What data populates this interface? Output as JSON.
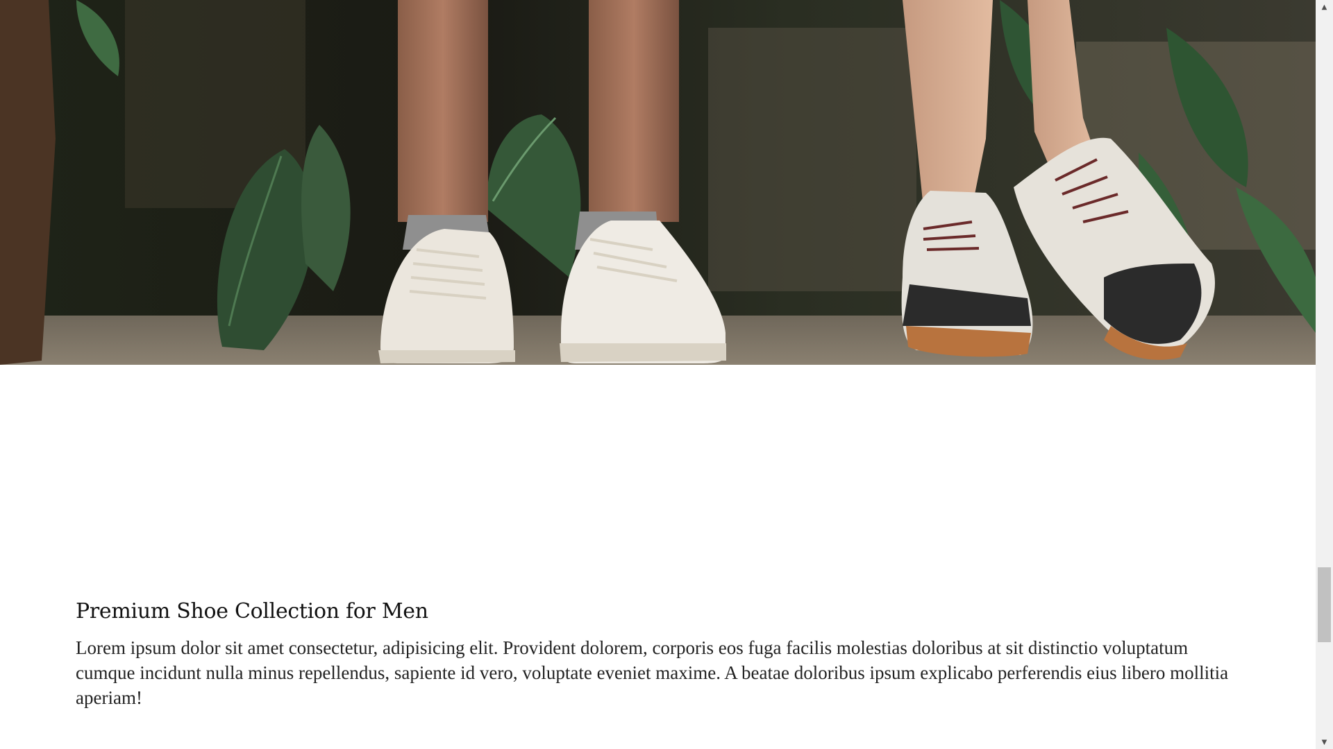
{
  "hero": {
    "image_alt": "Close-up of legs wearing white sneakers among tropical plants"
  },
  "section": {
    "title": "Premium Shoe Collection for Men",
    "body": "Lorem ipsum dolor sit amet consectetur, adipisicing elit. Provident dolorem, corporis eos fuga facilis molestias doloribus at sit distinctio voluptatum cumque incidunt nulla minus repellendus, sapiente id vero, voluptate eveniet maxime. A beatae doloribus ipsum explicabo perferendis eius libero mollitia aperiam!"
  },
  "scrollbar": {
    "up_icon": "triangle-up-icon",
    "down_icon": "triangle-down-icon",
    "up_glyph": "▲",
    "down_glyph": "▼"
  },
  "colors": {
    "background": "#ffffff",
    "text": "#222222",
    "heading": "#111111"
  }
}
